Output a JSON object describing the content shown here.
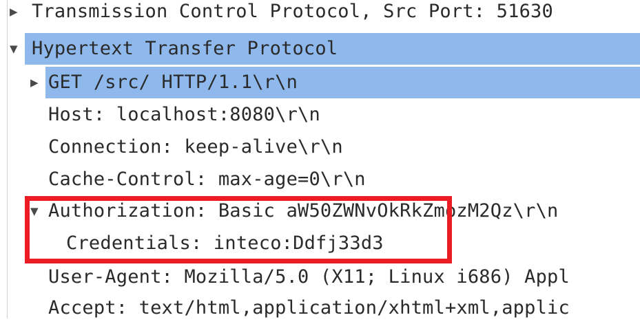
{
  "tree": {
    "rows": [
      {
        "label": "Transmission Control Protocol, Src Port: 51630",
        "arrow": "▶",
        "expanded": false,
        "selected": false
      },
      {
        "label": "Hypertext Transfer Protocol",
        "arrow": "▼",
        "expanded": true,
        "selected": true
      },
      {
        "label": "GET /src/ HTTP/1.1\\r\\n",
        "arrow": "▶",
        "expanded": false,
        "selected": true
      },
      {
        "label": "Host: localhost:8080\\r\\n"
      },
      {
        "label": "Connection: keep-alive\\r\\n"
      },
      {
        "label": "Cache-Control: max-age=0\\r\\n"
      },
      {
        "label": "Authorization: Basic aW50ZWNvOkRkZmozM2Qz\\r\\n",
        "arrow": "▼",
        "expanded": true
      },
      {
        "label": "Credentials: inteco:Ddfj33d3"
      },
      {
        "label": "User-Agent: Mozilla/5.0 (X11; Linux i686) Appl"
      },
      {
        "label": "Accept: text/html,application/xhtml+xml,applic"
      }
    ]
  },
  "colors": {
    "selection": "#8fb9ec",
    "highlight_box": "#ec1c24",
    "text": "#2a2a2a"
  }
}
